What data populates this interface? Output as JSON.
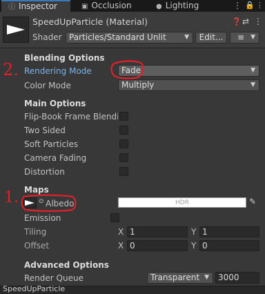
{
  "tabs": [
    {
      "label": "Inspector",
      "icon": "info-icon"
    },
    {
      "label": "Occlusion",
      "icon": "occlusion-icon"
    },
    {
      "label": "Lighting",
      "icon": "lightbulb-icon"
    }
  ],
  "header": {
    "title": "SpeedUpParticle (Material)",
    "shader_label": "Shader",
    "shader_value": "Particles/Standard Unlit",
    "edit_label": "Edit...",
    "list_icon": "≡"
  },
  "blending": {
    "heading": "Blending Options",
    "rendering_mode_label": "Rendering Mode",
    "rendering_mode_value": "Fade",
    "color_mode_label": "Color Mode",
    "color_mode_value": "Multiply"
  },
  "main_options": {
    "heading": "Main Options",
    "items": [
      {
        "label": "Flip-Book Frame Blendin",
        "checked": false
      },
      {
        "label": "Two Sided",
        "checked": false
      },
      {
        "label": "Soft Particles",
        "checked": false
      },
      {
        "label": "Camera Fading",
        "checked": false
      },
      {
        "label": "Distortion",
        "checked": false
      }
    ]
  },
  "maps": {
    "heading": "Maps",
    "albedo_label": "Albedo",
    "hdr_label": "HDR",
    "emission_label": "Emission",
    "tiling_label": "Tiling",
    "tiling_x": "1",
    "tiling_y": "1",
    "offset_label": "Offset",
    "offset_x": "0",
    "offset_y": "0",
    "x_axis": "X",
    "y_axis": "Y"
  },
  "advanced": {
    "heading": "Advanced Options",
    "render_queue_label": "Render Queue",
    "render_queue_value": "Transparent",
    "render_queue_number": "3000"
  },
  "footer": {
    "label": "SpeedUpParticle"
  },
  "annotations": {
    "one": "1.",
    "two": "2."
  },
  "colors": {
    "accent_blue": "#7bb4f0",
    "annotation_red": "#e0202a"
  }
}
